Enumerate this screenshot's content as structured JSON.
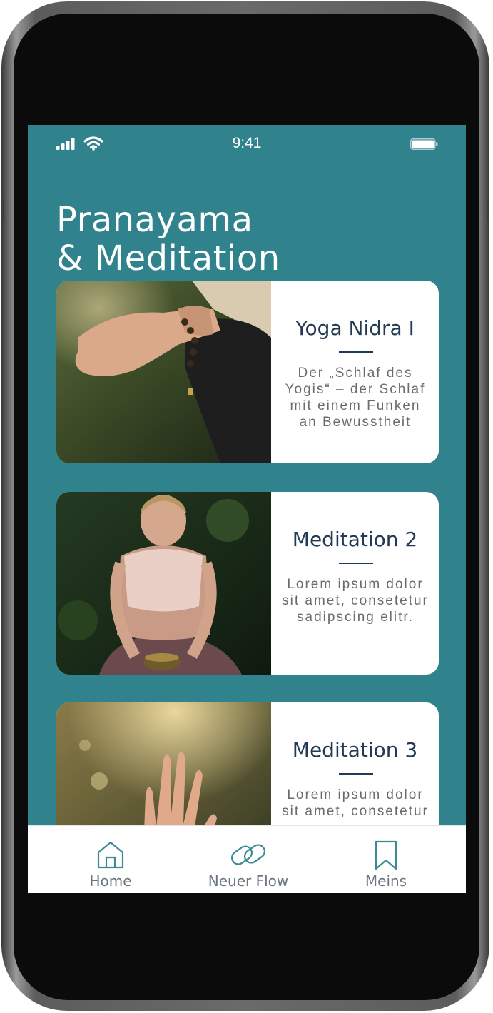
{
  "status_bar": {
    "time": "9:41",
    "icons": [
      "signal-icon",
      "wifi-icon",
      "battery-icon"
    ]
  },
  "page": {
    "title_line1": "Pranayama",
    "title_line2": "& Meditation"
  },
  "cards": [
    {
      "title": "Yoga Nidra I",
      "description": "Der „Schlaf des Yogis“ – der Schlaf mit einem Funken an Bewusstheit",
      "image": "photo-hand-mudra-with-mala-beads"
    },
    {
      "title": "Meditation 2",
      "description": "Lorem ipsum dolor sit amet, consetetur sadipscing elitr.",
      "image": "photo-woman-meditating-with-singing-bowl"
    },
    {
      "title": "Meditation 3",
      "description": "Lorem ipsum dolor sit amet, consetetur",
      "image": "photo-raised-hand-in-sunlight"
    }
  ],
  "bottom_nav": {
    "items": [
      {
        "label": "Home",
        "icon": "home-icon"
      },
      {
        "label": "Neuer Flow",
        "icon": "chain-link-icon"
      },
      {
        "label": "Meins",
        "icon": "bookmark-icon"
      }
    ]
  },
  "colors": {
    "screen_background": "#30828c",
    "card_title": "#233a54",
    "card_text": "#6b6b6b",
    "nav_icon": "#3d8a93",
    "nav_label": "#6a7580"
  }
}
